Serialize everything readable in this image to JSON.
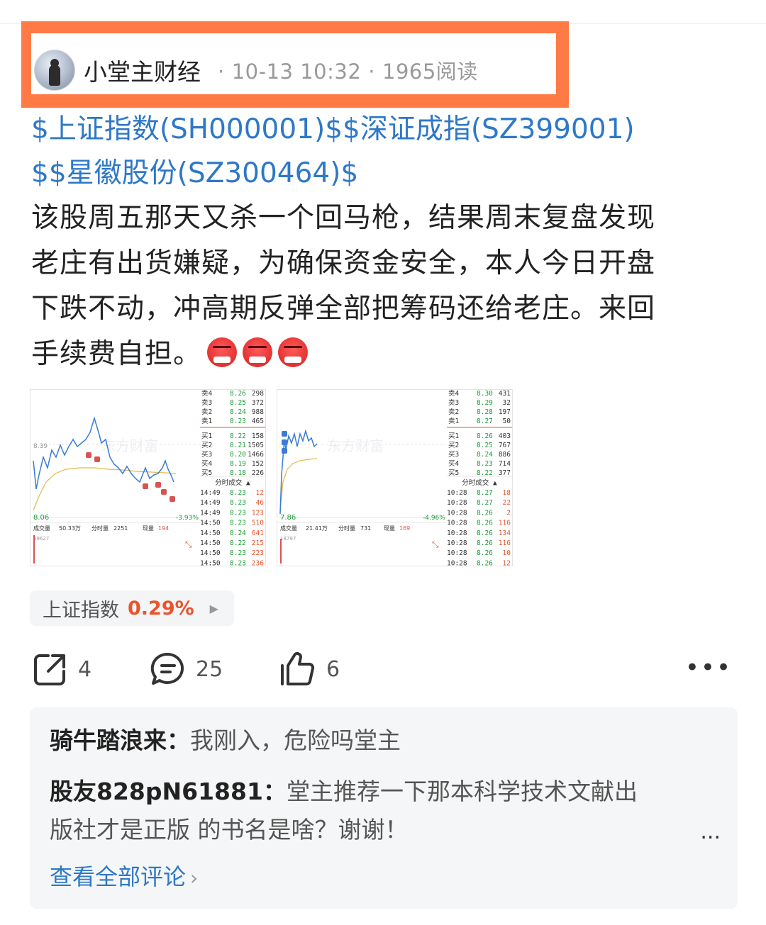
{
  "post": {
    "author": "小堂主财经",
    "date": "10-13 10:32",
    "reads": "1965阅读",
    "stock_links_line1": "$上证指数(SH000001)$$深证成指(SZ399001)",
    "stock_links_line2": "$$星徽股份(SZ300464)$",
    "body_line1": "该股周五那天又杀一个回马枪，结果周末复盘发现",
    "body_line2": "老庄有出货嫌疑，为确保资金安全，本人今日开盘",
    "body_line3": "下跌不动，冲高期反弹全部把筹码还给老庄。来回",
    "body_line4": "手续费自担。",
    "emoji_count": 3
  },
  "charts": [
    {
      "watermark": "东方财富",
      "price_high_label": "8.39",
      "price_low_label": "8.06",
      "change_label": "-3.93%",
      "vol_label": "成交量",
      "vol_value": "50.33万",
      "fenshi_label": "分时量",
      "fenshi_value": "2251",
      "xianliang_label": "现量",
      "xianliang_value": "194",
      "vol_axis": "39627",
      "sells": [
        [
          "卖4",
          "8.26",
          "298"
        ],
        [
          "卖3",
          "8.25",
          "372"
        ],
        [
          "卖2",
          "8.24",
          "988"
        ],
        [
          "卖1",
          "8.23",
          "465"
        ]
      ],
      "buys": [
        [
          "买1",
          "8.22",
          "158"
        ],
        [
          "买2",
          "8.21",
          "1505"
        ],
        [
          "买3",
          "8.20",
          "1466"
        ],
        [
          "买4",
          "8.19",
          "152"
        ],
        [
          "买5",
          "8.18",
          "226"
        ]
      ],
      "ticks_title": "分时成交",
      "ticks": [
        [
          "14:49",
          "8.23",
          "12"
        ],
        [
          "14:49",
          "8.23",
          "46"
        ],
        [
          "14:49",
          "8.23",
          "123"
        ],
        [
          "14:50",
          "8.23",
          "510"
        ],
        [
          "14:50",
          "8.24",
          "641"
        ],
        [
          "14:50",
          "8.22",
          "215"
        ],
        [
          "14:50",
          "8.23",
          "223"
        ],
        [
          "14:50",
          "8.23",
          "236"
        ]
      ]
    },
    {
      "watermark": "东方财富",
      "price_low_label": "7.86",
      "change_label": "-4.96%",
      "vol_label": "成交量",
      "vol_value": "21.41万",
      "fenshi_label": "分时量",
      "fenshi_value": "731",
      "xianliang_label": "现量",
      "xianliang_value": "169",
      "vol_axis": "18797",
      "sells": [
        [
          "卖4",
          "8.30",
          "431"
        ],
        [
          "卖3",
          "8.29",
          "32"
        ],
        [
          "卖2",
          "8.28",
          "197"
        ],
        [
          "卖1",
          "8.27",
          "50"
        ]
      ],
      "buys": [
        [
          "买1",
          "8.26",
          "403"
        ],
        [
          "买2",
          "8.25",
          "767"
        ],
        [
          "买3",
          "8.24",
          "886"
        ],
        [
          "买4",
          "8.23",
          "714"
        ],
        [
          "买5",
          "8.22",
          "377"
        ]
      ],
      "ticks_title": "分时成交",
      "ticks": [
        [
          "10:28",
          "8.27",
          "18"
        ],
        [
          "10:28",
          "8.27",
          "22"
        ],
        [
          "10:28",
          "8.26",
          "2"
        ],
        [
          "10:28",
          "8.26",
          "116"
        ],
        [
          "10:28",
          "8.26",
          "134"
        ],
        [
          "10:28",
          "8.26",
          "116"
        ],
        [
          "10:28",
          "8.26",
          "10"
        ],
        [
          "10:28",
          "8.26",
          "12"
        ]
      ]
    }
  ],
  "index_chip": {
    "name": "上证指数",
    "pct": "0.29%"
  },
  "actions": {
    "share_count": "4",
    "comment_count": "25",
    "like_count": "6"
  },
  "comments": [
    {
      "user": "骑牛踏浪来：",
      "text": "我刚入，危险吗堂主"
    },
    {
      "user": "股友828pN61881：",
      "text": "堂主推荐一下那本科学技术文献出",
      "text2": "版社才是正版 的书名是啥？谢谢！"
    }
  ],
  "comment_more": "...",
  "view_all": "查看全部评论",
  "colors": {
    "accent_blue": "#2e78c7",
    "highlight_orange": "#ff7a45",
    "up_red": "#e8542c",
    "down_green": "#1f9d3a"
  }
}
